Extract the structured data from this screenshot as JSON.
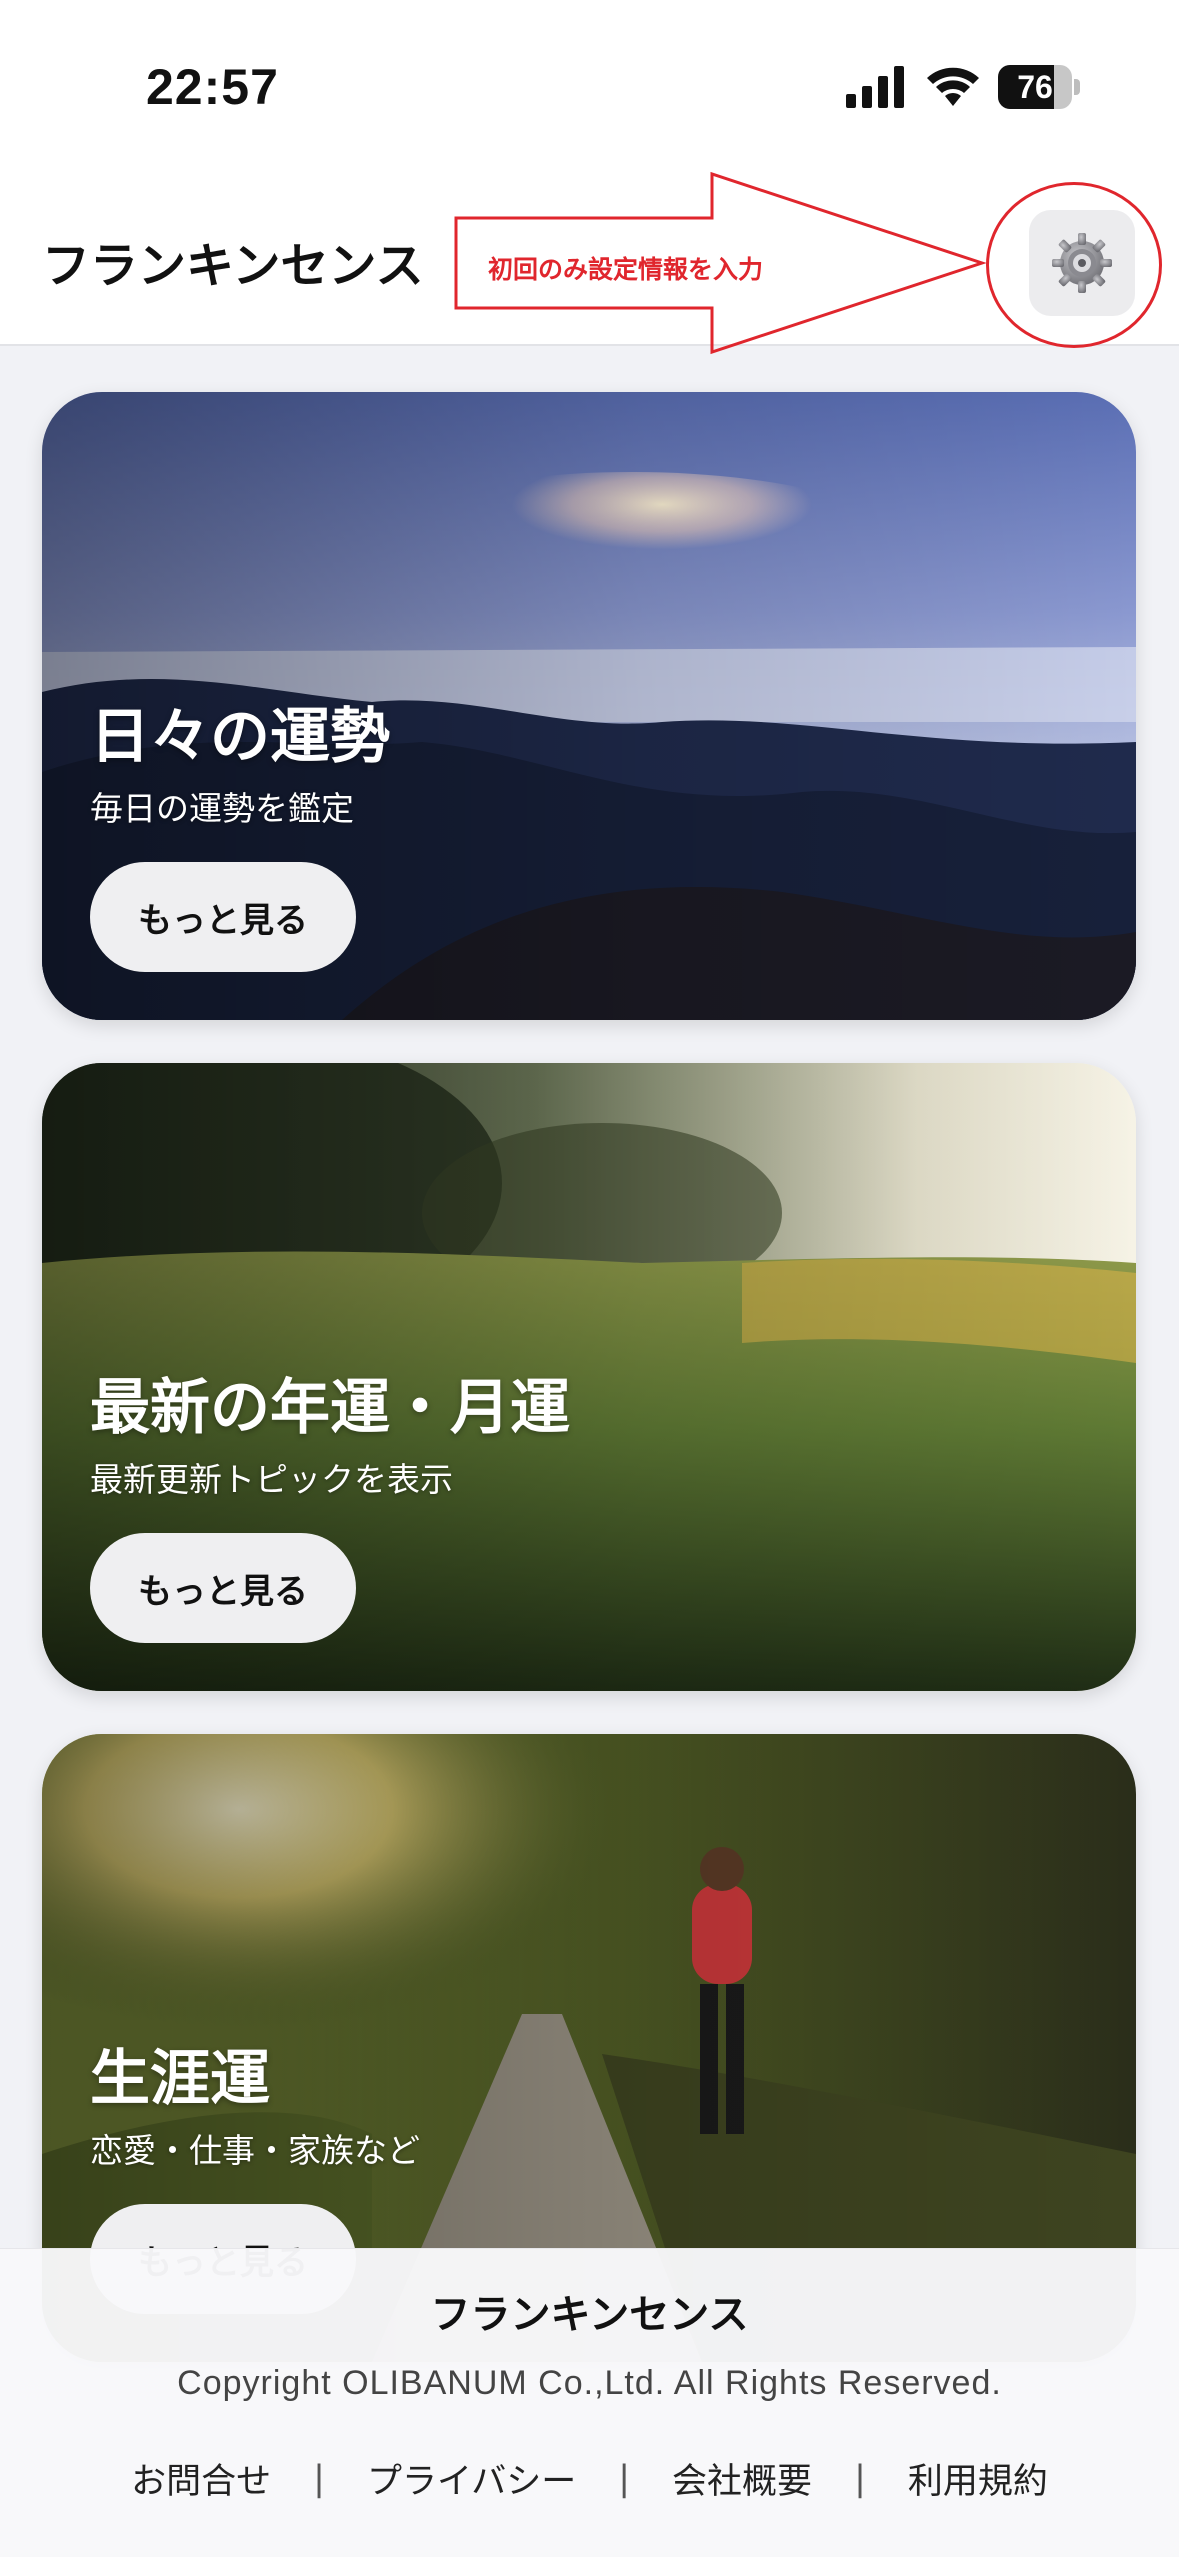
{
  "status_bar": {
    "time": "22:57",
    "battery": "76",
    "battery_level": 0.76
  },
  "header": {
    "title": "フランキンセンス"
  },
  "annotation": {
    "text": "初回のみ設定情報を入力",
    "color": "#e0262d"
  },
  "cards": [
    {
      "title": "日々の運勢",
      "subtitle": "毎日の運勢を鑑定",
      "button": "もっと見る"
    },
    {
      "title": "最新の年運・月運",
      "subtitle": "最新更新トピックを表示",
      "button": "もっと見る"
    },
    {
      "title": "生涯運",
      "subtitle": "恋愛・仕事・家族など",
      "button": "もっと見る"
    }
  ],
  "footer": {
    "brand": "フランキンセンス",
    "copyright": "Copyright OLIBANUM Co.,Ltd. All Rights Reserved.",
    "links": [
      "お問合せ",
      "プライバシー",
      "会社概要",
      "利用規約"
    ],
    "separator": "|"
  },
  "icons": [
    "cellular-signal-icon",
    "wifi-icon",
    "battery-icon",
    "gear-icon"
  ]
}
